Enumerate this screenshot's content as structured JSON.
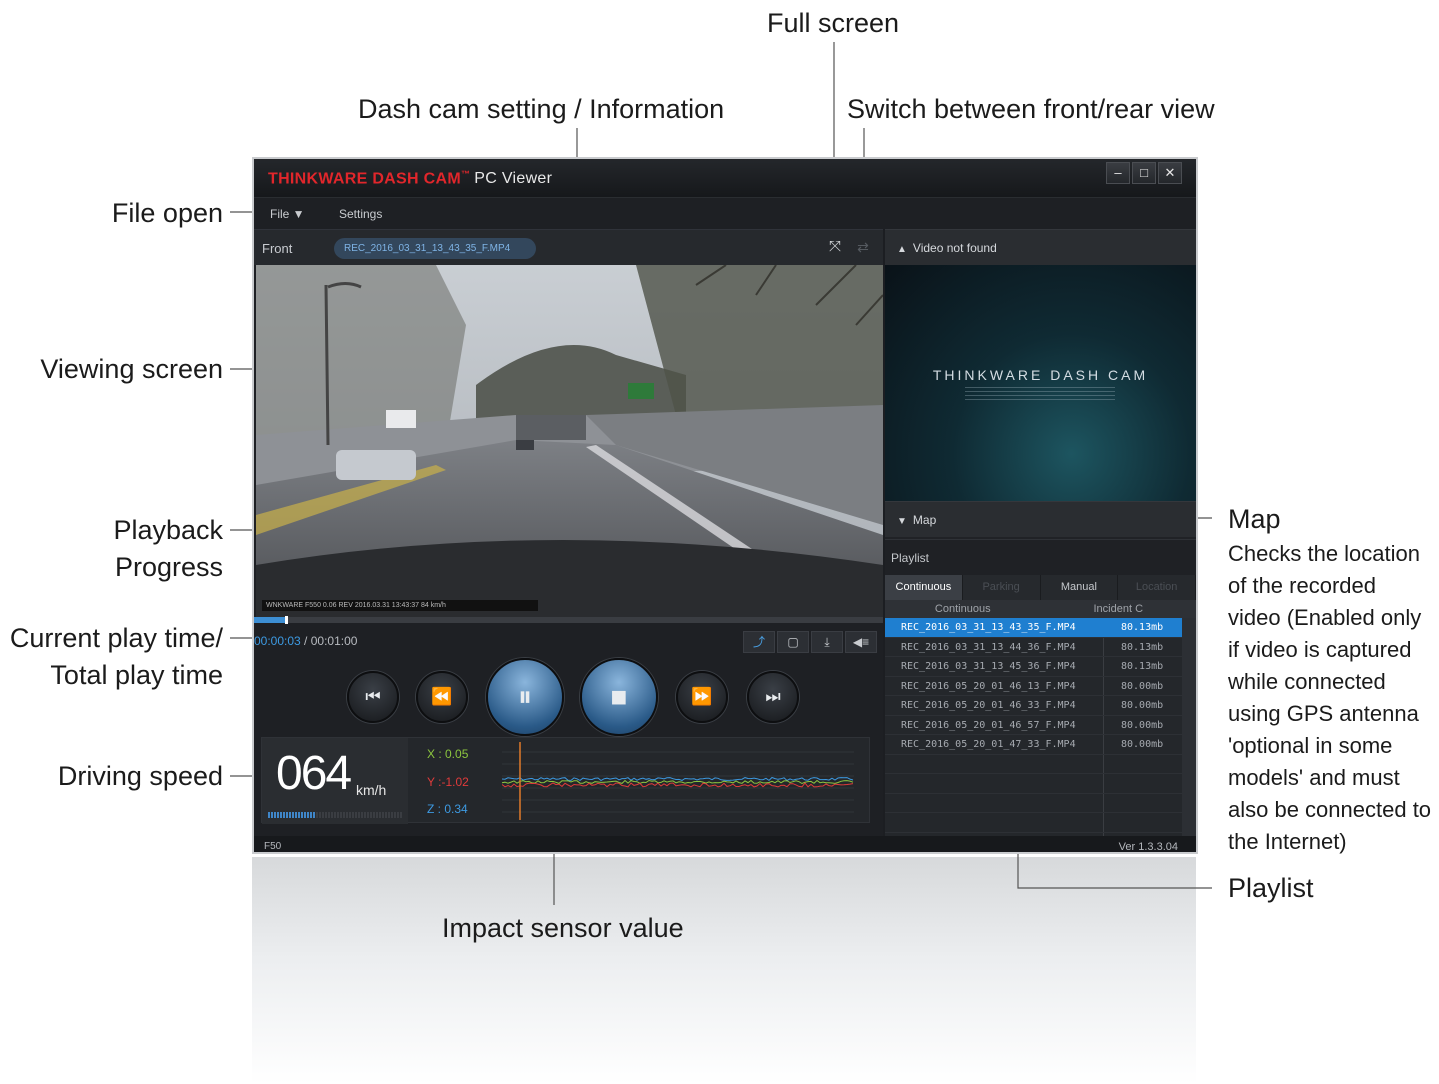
{
  "annotations": {
    "full_screen": "Full screen",
    "dash_cam_setting": "Dash cam setting / Information",
    "switch_view": "Switch between front/rear view",
    "file_open": "File open",
    "viewing_screen": "Viewing screen",
    "playback_progress_1": "Playback",
    "playback_progress_2": "Progress",
    "current_play_time_1": "Current play time/",
    "current_play_time_2": "Total play time",
    "driving_speed": "Driving speed",
    "impact_sensor": "Impact sensor value",
    "map_title": "Map",
    "map_desc": "Checks the location of the recorded video (Enabled only if video is captured while connected using GPS antenna 'optional in some models' and must also be connected to the Internet)",
    "playlist": "Playlist"
  },
  "window": {
    "brand": "THINKWARE DASH CAM",
    "brand_tm": "™",
    "brand_sub": "PC Viewer",
    "min": "–",
    "max": "□",
    "close": "✕"
  },
  "menu": {
    "file": "File ▼",
    "settings": "Settings"
  },
  "video_bar": {
    "camera": "Front",
    "filename": "REC_2016_03_31_13_43_35_F.MP4"
  },
  "video": {
    "overlay": "WNKWARE F550     0.06     REV     2016.03.31 13:43:37     84 km/h"
  },
  "playback": {
    "current": "00:00:03",
    "separator": " / ",
    "total": "00:01:00",
    "progress": 0.05
  },
  "tools": {
    "t1": "⤴",
    "t2": "▢",
    "t3": "⤓",
    "t4": "◀≡"
  },
  "controls": {
    "prev": "⏮",
    "rew": "⏪",
    "pause": "⏸",
    "stop": "■",
    "ff": "⏩",
    "next": "⏭"
  },
  "sensor": {
    "speed": "064",
    "unit": "km/h",
    "x": "X : 0.05",
    "y": "Y :-1.02",
    "z": "Z : 0.34",
    "speed_level": 0.35
  },
  "status": {
    "model": "F50",
    "version": "Ver 1.3.3.04"
  },
  "right_panel": {
    "video_header": "Video not found",
    "preview_title": "THINKWARE DASH CAM",
    "map_header": "Map",
    "playlist_label": "Playlist",
    "tabs": [
      "Continuous",
      "Parking",
      "Manual",
      "Location"
    ],
    "subtabs": [
      "Continuous",
      "Incident C"
    ],
    "files": [
      {
        "name": "REC_2016_03_31_13_43_35_F.MP4",
        "size": "80.13mb"
      },
      {
        "name": "REC_2016_03_31_13_44_36_F.MP4",
        "size": "80.13mb"
      },
      {
        "name": "REC_2016_03_31_13_45_36_F.MP4",
        "size": "80.13mb"
      },
      {
        "name": "REC_2016_05_20_01_46_13_F.MP4",
        "size": "80.00mb"
      },
      {
        "name": "REC_2016_05_20_01_46_33_F.MP4",
        "size": "80.00mb"
      },
      {
        "name": "REC_2016_05_20_01_46_57_F.MP4",
        "size": "80.00mb"
      },
      {
        "name": "REC_2016_05_20_01_47_33_F.MP4",
        "size": "80.00mb"
      }
    ]
  },
  "colors": {
    "accent": "#1f7fd0",
    "brand_red": "#e1262b",
    "x_axis": "#8cc63f",
    "y_axis": "#e03b3b",
    "z_axis": "#3d9ae2",
    "leader": "#9a64a8"
  }
}
